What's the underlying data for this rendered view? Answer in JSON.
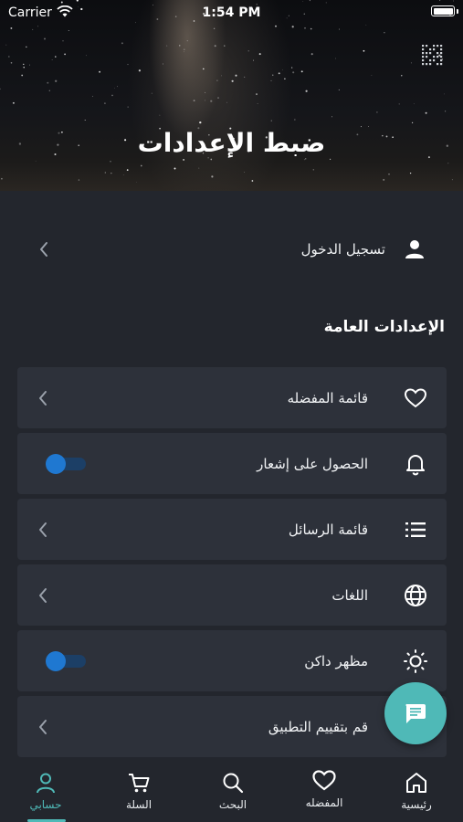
{
  "status_bar": {
    "carrier": "Carrier",
    "time": "1:54 PM"
  },
  "header": {
    "title": "ضبط الإعدادات"
  },
  "login_row": {
    "label": "تسجيل الدخول",
    "icon": "person-icon"
  },
  "section_title": "الإعدادات العامة",
  "settings": [
    {
      "label": "قائمة المفضله",
      "icon": "heart-icon",
      "control": "chevron"
    },
    {
      "label": "الحصول على إشعار",
      "icon": "bell-icon",
      "control": "toggle",
      "enabled": true
    },
    {
      "label": "قائمة الرسائل",
      "icon": "list-icon",
      "control": "chevron"
    },
    {
      "label": "اللغات",
      "icon": "globe-icon",
      "control": "chevron"
    },
    {
      "label": "مظهر داكن",
      "icon": "sun-icon",
      "control": "toggle",
      "enabled": true
    },
    {
      "label": "قم بتقييم التطبيق",
      "icon": "star-icon",
      "control": "chevron"
    }
  ],
  "fab": {
    "icon": "chat-icon"
  },
  "tabs": [
    {
      "label": "رئيسية",
      "icon": "home-icon"
    },
    {
      "label": "المفضله",
      "icon": "heart-icon"
    },
    {
      "label": "البحث",
      "icon": "search-icon"
    },
    {
      "label": "السلة",
      "icon": "cart-icon"
    },
    {
      "label": "حسابي",
      "icon": "user-icon",
      "active": true
    }
  ],
  "colors": {
    "accent": "#4fb9b7",
    "toggle": "#1f78d1",
    "card": "#2d313a",
    "background": "#23262d"
  }
}
